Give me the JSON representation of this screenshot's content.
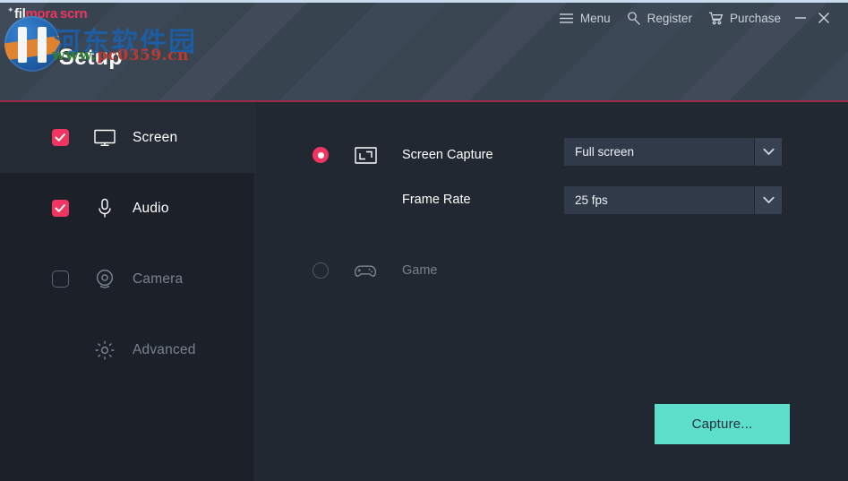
{
  "window": {
    "title": "Setup",
    "brand": {
      "part1": "fil",
      "part2": "mora",
      "part3": "scrn"
    }
  },
  "titlebar": {
    "items": [
      {
        "icon": "hamburger-menu-icon",
        "label": "Menu"
      },
      {
        "icon": "key-icon",
        "label": "Register"
      },
      {
        "icon": "shopping-cart-icon",
        "label": "Purchase"
      }
    ],
    "minimize": "—",
    "close": "✕"
  },
  "watermark": {
    "chinese": "河东软件园",
    "url_prefix": "www.",
    "url_main": "pc0359.cn"
  },
  "sidebar": {
    "items": [
      {
        "label": "Screen",
        "icon": "monitor-icon",
        "checked": true,
        "active": true,
        "enabled": true
      },
      {
        "label": "Audio",
        "icon": "microphone-icon",
        "checked": true,
        "active": false,
        "enabled": true
      },
      {
        "label": "Camera",
        "icon": "webcam-icon",
        "checked": false,
        "active": false,
        "enabled": false
      },
      {
        "label": "Advanced",
        "icon": "gear-icon",
        "checked": null,
        "active": false,
        "enabled": false
      }
    ]
  },
  "main": {
    "screen_capture": {
      "radio_selected": true,
      "icon": "crop-frame-icon",
      "label": "Screen Capture",
      "select_value": "Full screen"
    },
    "frame_rate": {
      "label": "Frame Rate",
      "select_value": "25 fps"
    },
    "game": {
      "radio_selected": false,
      "icon": "gamepad-icon",
      "label": "Game"
    },
    "capture_button": "Capture..."
  },
  "colors": {
    "accent_pink": "#ef3560",
    "accent_mint": "#5edfcb",
    "header_bg": "#3b4654",
    "body_bg": "#222831",
    "sidebar_bg": "#1c2029",
    "underline": "#9e2a48"
  }
}
